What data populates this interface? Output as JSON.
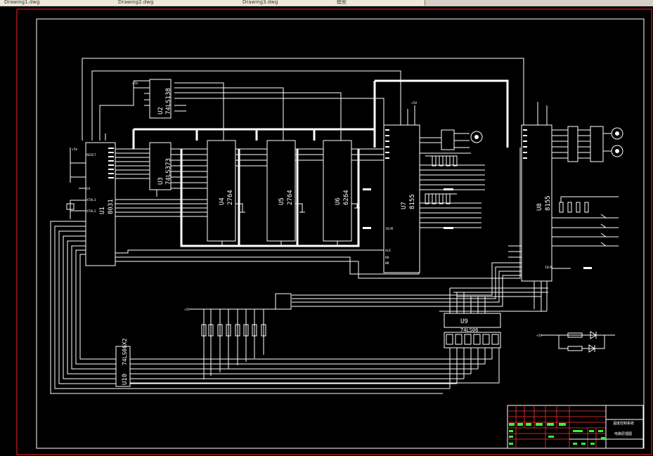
{
  "tabs": [
    {
      "label": "Drawing1.dwg"
    },
    {
      "label": "Drawing2.dwg"
    },
    {
      "label": "Drawing3.dwg"
    },
    {
      "label": "模型"
    }
  ],
  "chips": {
    "u1": {
      "ref": "U1",
      "part": "8031"
    },
    "u2": {
      "ref": "U2",
      "part": "74LS138"
    },
    "u3": {
      "ref": "U3",
      "part": "74LS373"
    },
    "u4": {
      "ref": "U4",
      "part": "2764"
    },
    "u5": {
      "ref": "U5",
      "part": "2764"
    },
    "u6": {
      "ref": "U6",
      "part": "6264"
    },
    "u7": {
      "ref": "U7",
      "part": "8155"
    },
    "u8": {
      "ref": "U8",
      "part": "8155"
    },
    "u9": {
      "ref": "U9",
      "part": "74LS06"
    },
    "u10": {
      "ref": "U10",
      "part": "74LS06X2"
    }
  },
  "pins": {
    "reset": "RESET",
    "xtal1": "XTAL1",
    "xtal2": "XTAL2",
    "ea": "EA",
    "ale": "ALE",
    "rd": "RD",
    "wr": "WR",
    "io_m": "IO/M",
    "vcc": "+5V"
  },
  "net_labels": {
    "n1": "+5V",
    "n2": "+5V",
    "n3": "+5V",
    "n4": "+5V"
  },
  "title_block": {
    "title_line1": "温度控制系统",
    "title_line2": "电路原理图"
  }
}
